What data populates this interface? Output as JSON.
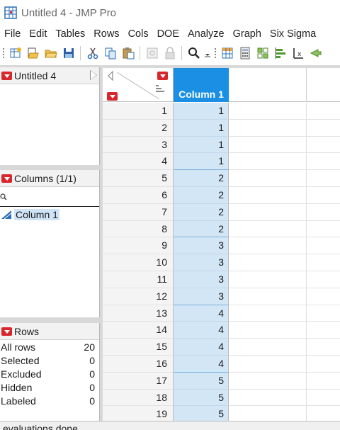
{
  "window": {
    "title": "Untitled 4 - JMP Pro"
  },
  "menu": [
    "File",
    "Edit",
    "Tables",
    "Rows",
    "Cols",
    "DOE",
    "Analyze",
    "Graph",
    "Six Sigma"
  ],
  "toolbar": {
    "icons": [
      "new-data-table-icon",
      "open-data-table-icon",
      "open-folder-icon",
      "save-icon",
      "cut-icon",
      "copy-icon",
      "paste-icon",
      "data-grid-icon",
      "lock-icon",
      "search-icon",
      "table-icon",
      "calculator-icon",
      "grid-layout-icon",
      "bar-chart-icon",
      "formula-icon",
      "arrow-icon"
    ]
  },
  "table_panel": {
    "title": "Untitled 4"
  },
  "columns_panel": {
    "title": "Columns (1/1)",
    "columns": [
      "Column 1"
    ]
  },
  "rows_panel": {
    "title": "Rows",
    "stats": [
      {
        "label": "All rows",
        "value": "20"
      },
      {
        "label": "Selected",
        "value": "0"
      },
      {
        "label": "Excluded",
        "value": "0"
      },
      {
        "label": "Hidden",
        "value": "0"
      },
      {
        "label": "Labeled",
        "value": "0"
      }
    ]
  },
  "grid": {
    "column_header": "Column 1",
    "rows": [
      {
        "n": "1",
        "v": "1"
      },
      {
        "n": "2",
        "v": "1"
      },
      {
        "n": "3",
        "v": "1"
      },
      {
        "n": "4",
        "v": "1"
      },
      {
        "n": "5",
        "v": "2"
      },
      {
        "n": "6",
        "v": "2"
      },
      {
        "n": "7",
        "v": "2"
      },
      {
        "n": "8",
        "v": "2"
      },
      {
        "n": "9",
        "v": "3"
      },
      {
        "n": "10",
        "v": "3"
      },
      {
        "n": "11",
        "v": "3"
      },
      {
        "n": "12",
        "v": "3"
      },
      {
        "n": "13",
        "v": "4"
      },
      {
        "n": "14",
        "v": "4"
      },
      {
        "n": "15",
        "v": "4"
      },
      {
        "n": "16",
        "v": "4"
      },
      {
        "n": "17",
        "v": "5"
      },
      {
        "n": "18",
        "v": "5"
      },
      {
        "n": "19",
        "v": "5"
      }
    ]
  },
  "status": {
    "text": "evaluations done"
  },
  "colors": {
    "accent": "#1a8fe3",
    "selected_cell": "#d3e6f6",
    "red_triangle": "#d8262d"
  }
}
